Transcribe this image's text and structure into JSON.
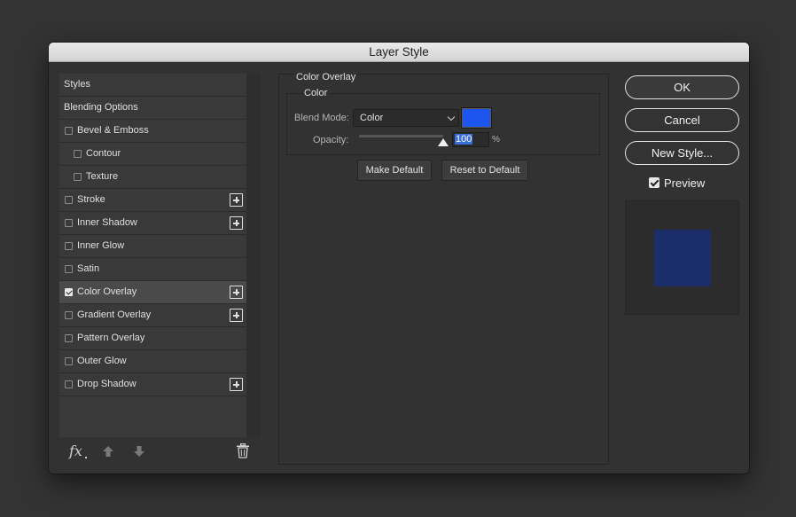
{
  "window": {
    "title": "Layer Style"
  },
  "styles_list": {
    "items": [
      {
        "label": "Styles",
        "checkbox": false,
        "checked": false,
        "indent": 0,
        "plus": false,
        "selected": false
      },
      {
        "label": "Blending Options",
        "checkbox": false,
        "checked": false,
        "indent": 0,
        "plus": false,
        "selected": false
      },
      {
        "label": "Bevel & Emboss",
        "checkbox": true,
        "checked": false,
        "indent": 0,
        "plus": false,
        "selected": false
      },
      {
        "label": "Contour",
        "checkbox": true,
        "checked": false,
        "indent": 1,
        "plus": false,
        "selected": false
      },
      {
        "label": "Texture",
        "checkbox": true,
        "checked": false,
        "indent": 1,
        "plus": false,
        "selected": false
      },
      {
        "label": "Stroke",
        "checkbox": true,
        "checked": false,
        "indent": 0,
        "plus": true,
        "selected": false
      },
      {
        "label": "Inner Shadow",
        "checkbox": true,
        "checked": false,
        "indent": 0,
        "plus": true,
        "selected": false
      },
      {
        "label": "Inner Glow",
        "checkbox": true,
        "checked": false,
        "indent": 0,
        "plus": false,
        "selected": false
      },
      {
        "label": "Satin",
        "checkbox": true,
        "checked": false,
        "indent": 0,
        "plus": false,
        "selected": false
      },
      {
        "label": "Color Overlay",
        "checkbox": true,
        "checked": true,
        "indent": 0,
        "plus": true,
        "selected": true
      },
      {
        "label": "Gradient Overlay",
        "checkbox": true,
        "checked": false,
        "indent": 0,
        "plus": true,
        "selected": false
      },
      {
        "label": "Pattern Overlay",
        "checkbox": true,
        "checked": false,
        "indent": 0,
        "plus": false,
        "selected": false
      },
      {
        "label": "Outer Glow",
        "checkbox": true,
        "checked": false,
        "indent": 0,
        "plus": false,
        "selected": false
      },
      {
        "label": "Drop Shadow",
        "checkbox": true,
        "checked": false,
        "indent": 0,
        "plus": true,
        "selected": false
      }
    ],
    "footer": {
      "fx_label": "fx",
      "icons": [
        "fx-icon",
        "move-up-icon",
        "move-down-icon",
        "trash-icon"
      ]
    }
  },
  "color_overlay": {
    "section_title": "Color Overlay",
    "group_title": "Color",
    "blend_mode_label": "Blend Mode:",
    "blend_mode_value": "Color",
    "color_hex": "#1f55ef",
    "opacity_label": "Opacity:",
    "opacity_value": "100",
    "opacity_unit": "%",
    "opacity_fraction": 1.0,
    "make_default_label": "Make Default",
    "reset_default_label": "Reset to Default"
  },
  "actions": {
    "ok_label": "OK",
    "cancel_label": "Cancel",
    "new_style_label": "New Style...",
    "preview_label": "Preview",
    "preview_checked": true,
    "preview_swatch_hex": "#1c2d6c"
  }
}
